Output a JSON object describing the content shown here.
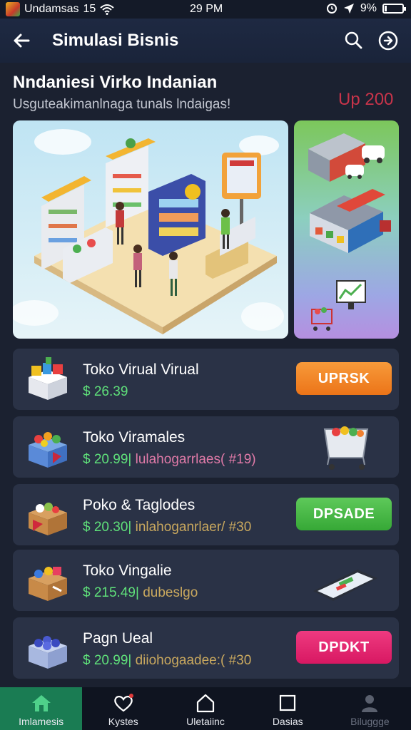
{
  "status_bar": {
    "carrier": "Undamsas",
    "network": "15",
    "time": "29 PM",
    "battery": "9%",
    "icons": [
      "app-icon",
      "wifi-icon",
      "alarm-icon",
      "location-icon",
      "battery-icon"
    ]
  },
  "app_bar": {
    "title": "Simulasi Bisnis",
    "icons": [
      "back-arrow-icon",
      "search-icon",
      "forward-circle-icon"
    ]
  },
  "header": {
    "headline": "Nndaniesi Virko Indanian",
    "subline": "Usguteakimanlnaga tunals lndaigas!",
    "badge": "Up 200"
  },
  "stores": [
    {
      "name": "Toko Virual Virual",
      "price": "$ 26.39",
      "extra": "",
      "action": "UPRSK",
      "action_color": "#f07d1e",
      "icon": "toy-box-icon"
    },
    {
      "name": "Toko Viramales",
      "price": "$ 20.99|",
      "extra": "lulahogarrlaes( #19)",
      "action": "",
      "action_color": "",
      "icon": "fruit-crate-icon",
      "side_icon": "shopping-cart-icon"
    },
    {
      "name": "Poko & Taglodes",
      "price": "$ 20.30|",
      "extra": "inlahoganrlaer/ #30",
      "action": "DPSADE",
      "action_color": "#3fb43f",
      "icon": "vegetable-box-icon"
    },
    {
      "name": "Toko Vingalie",
      "price": "$ 215.49|",
      "extra": "dubeslgo",
      "action": "",
      "action_color": "",
      "icon": "crafts-box-icon",
      "side_icon": "smartphone-icon"
    },
    {
      "name": "Pagn Ueal",
      "price": "$ 20.99|",
      "extra": "diiohogaadee:( #30",
      "action": "DPDKT",
      "action_color": "#e01e6a",
      "icon": "blue-crate-icon"
    }
  ],
  "bottom_nav": [
    {
      "label": "Imlamesis",
      "icon": "home-icon",
      "active": true
    },
    {
      "label": "Kystes",
      "icon": "heart-icon",
      "active": false
    },
    {
      "label": "Uletaiinc",
      "icon": "house-outline-icon",
      "active": false
    },
    {
      "label": "Dasias",
      "icon": "square-icon",
      "active": false
    },
    {
      "label": "Biluggge",
      "icon": "profile-icon",
      "active": false
    }
  ]
}
